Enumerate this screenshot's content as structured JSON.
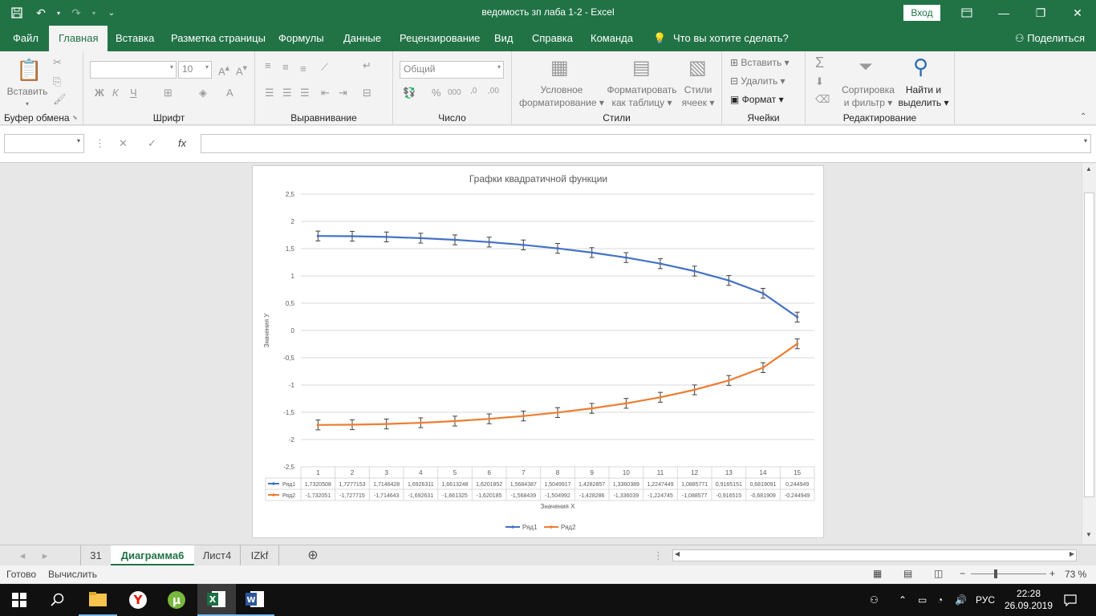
{
  "window": {
    "title": "ведомость зп лаба 1-2  -  Excel",
    "login_label": "Вход"
  },
  "ribbon_tabs": [
    "Файл",
    "Главная",
    "Вставка",
    "Разметка страницы",
    "Формулы",
    "Данные",
    "Рецензирование",
    "Вид",
    "Справка",
    "Команда"
  ],
  "active_tab": "Главная",
  "tell_me": "Что вы хотите сделать?",
  "share_label": "Поделиться",
  "ribbon": {
    "clipboard": {
      "label": "Буфер обмена",
      "paste": "Вставить"
    },
    "font": {
      "label": "Шрифт",
      "size": "10",
      "bold": "Ж",
      "italic": "К",
      "underline": "Ч"
    },
    "alignment": {
      "label": "Выравнивание"
    },
    "number": {
      "label": "Число",
      "format": "Общий"
    },
    "styles": {
      "label": "Стили",
      "conditional_1": "Условное",
      "conditional_2": "форматирование",
      "table_1": "Форматировать",
      "table_2": "как таблицу",
      "cell_1": "Стили",
      "cell_2": "ячеек"
    },
    "cells": {
      "label": "Ячейки",
      "insert": "Вставить",
      "delete": "Удалить",
      "format": "Формат"
    },
    "editing": {
      "label": "Редактирование",
      "sort_1": "Сортировка",
      "sort_2": "и фильтр",
      "find_1": "Найти и",
      "find_2": "выделить"
    }
  },
  "formula_bar": {
    "fx": "fx"
  },
  "chart_data": {
    "type": "line",
    "title": "Графки квадратичной функции",
    "xlabel": "Значения X",
    "ylabel": "Значения У",
    "ylim": [
      -2.5,
      2.5
    ],
    "ytick_labels": [
      "2,5",
      "2",
      "1,5",
      "1",
      "0,5",
      "0",
      "-0,5",
      "-1",
      "-1,5",
      "-2",
      "-2,5"
    ],
    "categories": [
      "1",
      "2",
      "3",
      "4",
      "5",
      "6",
      "7",
      "8",
      "9",
      "10",
      "11",
      "12",
      "13",
      "14",
      "15"
    ],
    "series": [
      {
        "name": "Ряд1",
        "color": "#4472c4",
        "values": [
          1.7320508,
          1.7277153,
          1.7146428,
          1.6926311,
          1.6613248,
          1.6201852,
          1.5684387,
          1.5049917,
          1.4282857,
          1.3360389,
          1.2247449,
          1.0885771,
          0.9165151,
          0.6819091,
          0.244949
        ],
        "labels": [
          "1,7320508",
          "1,7277153",
          "1,7146428",
          "1,6926311",
          "1,6613248",
          "1,6201852",
          "1,5684387",
          "1,5049917",
          "1,4282857",
          "1,3360389",
          "1,2247449",
          "1,0885771",
          "0,9165151",
          "0,6819091",
          "0,244949"
        ]
      },
      {
        "name": "Ряд2",
        "color": "#ed7d31",
        "values": [
          -1.732051,
          -1.727715,
          -1.714643,
          -1.692631,
          -1.661325,
          -1.620185,
          -1.568439,
          -1.504992,
          -1.428286,
          -1.336039,
          -1.224745,
          -1.088577,
          -0.916515,
          -0.681909,
          -0.244949
        ],
        "labels": [
          "-1,732051",
          "-1,727715",
          "-1,714643",
          "-1,692631",
          "-1,661325",
          "-1,620185",
          "-1,568439",
          "-1,504992",
          "-1,428286",
          "-1,336039",
          "-1,224745",
          "-1,088577",
          "-0,916515",
          "-0,681909",
          "-0,244949"
        ]
      }
    ],
    "error_bars": true,
    "data_table": true,
    "legend": "bottom",
    "grid": true
  },
  "sheets": [
    "31",
    "Диаграмма6",
    "Лист4",
    "IZkf"
  ],
  "active_sheet": "Диаграмма6",
  "status": {
    "ready": "Готово",
    "calc": "Вычислить",
    "zoom": "73 %"
  },
  "taskbar": {
    "lang": "РУС",
    "time": "22:28",
    "date": "26.09.2019"
  }
}
